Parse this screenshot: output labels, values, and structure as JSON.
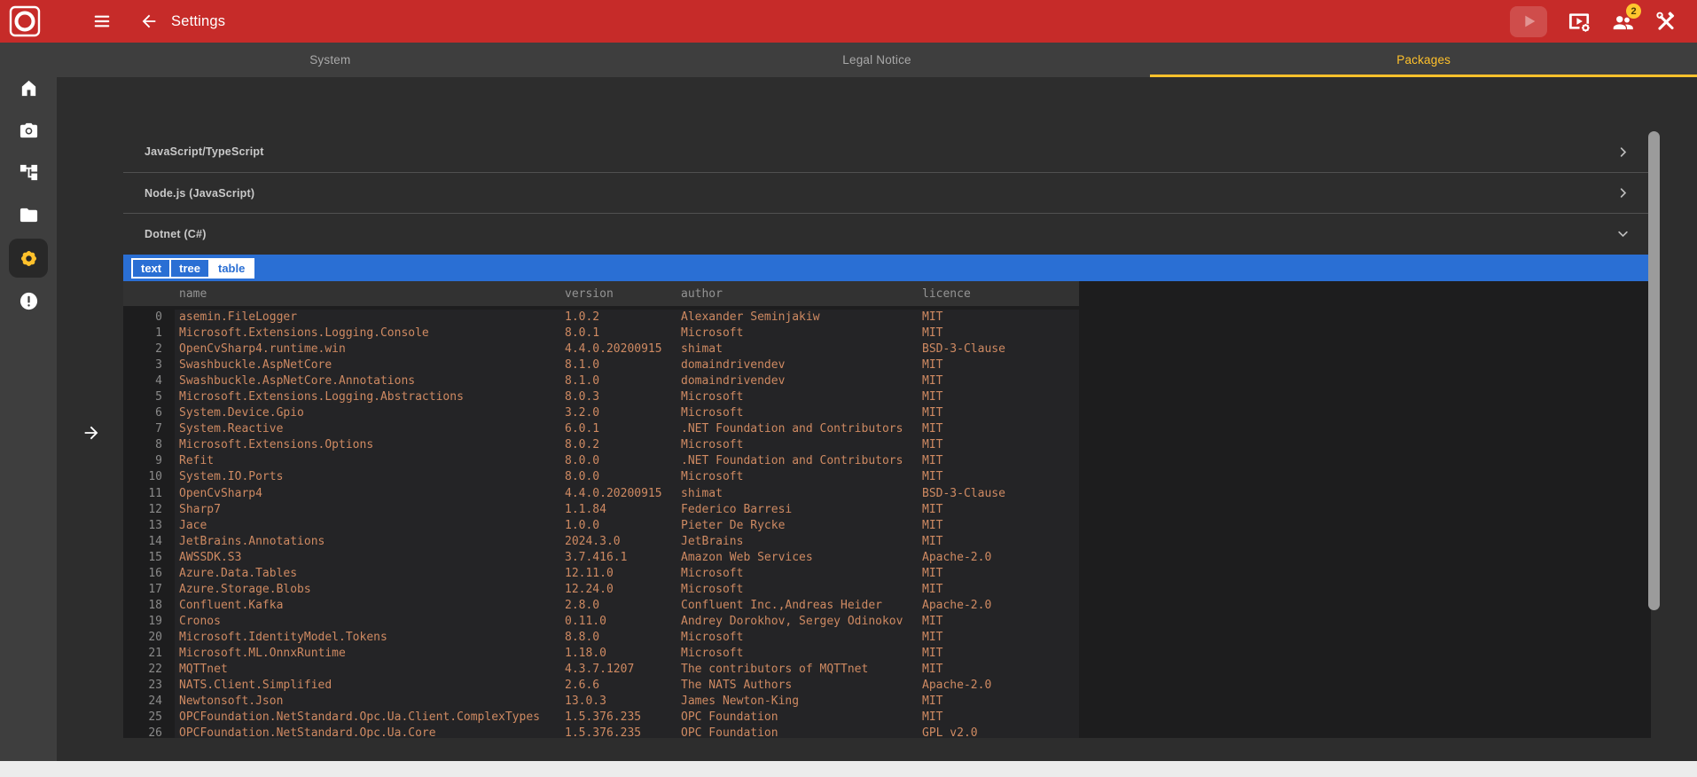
{
  "topbar": {
    "title": "Settings",
    "users_badge_count": "2"
  },
  "tabs": [
    {
      "label": "System",
      "active": false
    },
    {
      "label": "Legal Notice",
      "active": false
    },
    {
      "label": "Packages",
      "active": true
    }
  ],
  "sidebar": {
    "items": [
      {
        "icon": "home-icon",
        "active": false
      },
      {
        "icon": "camera-icon",
        "active": false
      },
      {
        "icon": "account-tree-icon",
        "active": false
      },
      {
        "icon": "folder-icon",
        "active": false
      },
      {
        "icon": "settings-gear-icon",
        "active": true
      },
      {
        "icon": "error-icon",
        "active": false
      }
    ]
  },
  "icons": [
    "logo-o",
    "hamburger-menu",
    "back-arrow",
    "play",
    "video-settings",
    "users",
    "construction-tools",
    "chevron-right",
    "chevron-down",
    "expand-right-arrow"
  ],
  "panels": [
    {
      "label": "JavaScript/TypeScript",
      "expanded": false
    },
    {
      "label": "Node.js (JavaScript)",
      "expanded": false
    },
    {
      "label": "Dotnet (C#)",
      "expanded": true
    }
  ],
  "view_toggle": {
    "options": [
      "text",
      "tree",
      "table"
    ],
    "selected": "table"
  },
  "table": {
    "columns": {
      "name": "name",
      "version": "version",
      "author": "author",
      "licence": "licence"
    },
    "rows": [
      {
        "i": "0",
        "name": "asemin.FileLogger",
        "version": "1.0.2",
        "author": "Alexander Seminjakiw",
        "licence": "MIT"
      },
      {
        "i": "1",
        "name": "Microsoft.Extensions.Logging.Console",
        "version": "8.0.1",
        "author": "Microsoft",
        "licence": "MIT"
      },
      {
        "i": "2",
        "name": "OpenCvSharp4.runtime.win",
        "version": "4.4.0.20200915",
        "author": "shimat",
        "licence": "BSD-3-Clause"
      },
      {
        "i": "3",
        "name": "Swashbuckle.AspNetCore",
        "version": "8.1.0",
        "author": "domaindrivendev",
        "licence": "MIT"
      },
      {
        "i": "4",
        "name": "Swashbuckle.AspNetCore.Annotations",
        "version": "8.1.0",
        "author": "domaindrivendev",
        "licence": "MIT"
      },
      {
        "i": "5",
        "name": "Microsoft.Extensions.Logging.Abstractions",
        "version": "8.0.3",
        "author": "Microsoft",
        "licence": "MIT"
      },
      {
        "i": "6",
        "name": "System.Device.Gpio",
        "version": "3.2.0",
        "author": "Microsoft",
        "licence": "MIT"
      },
      {
        "i": "7",
        "name": "System.Reactive",
        "version": "6.0.1",
        "author": ".NET Foundation and Contributors",
        "licence": "MIT"
      },
      {
        "i": "8",
        "name": "Microsoft.Extensions.Options",
        "version": "8.0.2",
        "author": "Microsoft",
        "licence": "MIT"
      },
      {
        "i": "9",
        "name": "Refit",
        "version": "8.0.0",
        "author": ".NET Foundation and Contributors",
        "licence": "MIT"
      },
      {
        "i": "10",
        "name": "System.IO.Ports",
        "version": "8.0.0",
        "author": "Microsoft",
        "licence": "MIT"
      },
      {
        "i": "11",
        "name": "OpenCvSharp4",
        "version": "4.4.0.20200915",
        "author": "shimat",
        "licence": "BSD-3-Clause"
      },
      {
        "i": "12",
        "name": "Sharp7",
        "version": "1.1.84",
        "author": "Federico Barresi",
        "licence": "MIT"
      },
      {
        "i": "13",
        "name": "Jace",
        "version": "1.0.0",
        "author": "Pieter De Rycke",
        "licence": "MIT"
      },
      {
        "i": "14",
        "name": "JetBrains.Annotations",
        "version": "2024.3.0",
        "author": "JetBrains",
        "licence": "MIT"
      },
      {
        "i": "15",
        "name": "AWSSDK.S3",
        "version": "3.7.416.1",
        "author": "Amazon Web Services",
        "licence": "Apache-2.0"
      },
      {
        "i": "16",
        "name": "Azure.Data.Tables",
        "version": "12.11.0",
        "author": "Microsoft",
        "licence": "MIT"
      },
      {
        "i": "17",
        "name": "Azure.Storage.Blobs",
        "version": "12.24.0",
        "author": "Microsoft",
        "licence": "MIT"
      },
      {
        "i": "18",
        "name": "Confluent.Kafka",
        "version": "2.8.0",
        "author": "Confluent Inc.,Andreas Heider",
        "licence": "Apache-2.0"
      },
      {
        "i": "19",
        "name": "Cronos",
        "version": "0.11.0",
        "author": "Andrey Dorokhov, Sergey Odinokov",
        "licence": "MIT"
      },
      {
        "i": "20",
        "name": "Microsoft.IdentityModel.Tokens",
        "version": "8.8.0",
        "author": "Microsoft",
        "licence": "MIT"
      },
      {
        "i": "21",
        "name": "Microsoft.ML.OnnxRuntime",
        "version": "1.18.0",
        "author": "Microsoft",
        "licence": "MIT"
      },
      {
        "i": "22",
        "name": "MQTTnet",
        "version": "4.3.7.1207",
        "author": "The contributors of MQTTnet",
        "licence": "MIT"
      },
      {
        "i": "23",
        "name": "NATS.Client.Simplified",
        "version": "2.6.6",
        "author": "The NATS Authors",
        "licence": "Apache-2.0"
      },
      {
        "i": "24",
        "name": "Newtonsoft.Json",
        "version": "13.0.3",
        "author": "James Newton-King",
        "licence": "MIT"
      },
      {
        "i": "25",
        "name": "OPCFoundation.NetStandard.Opc.Ua.Client.ComplexTypes",
        "version": "1.5.376.235",
        "author": "OPC Foundation",
        "licence": "MIT"
      },
      {
        "i": "26",
        "name": "OPCFoundation.NetStandard.Opc.Ua.Core",
        "version": "1.5.376.235",
        "author": "OPC Foundation",
        "licence": "GPL v2.0"
      }
    ]
  },
  "colors": {
    "brand_red": "#C62B29",
    "accent_amber": "#FFC12B",
    "toolbar_blue": "#2A6FD4",
    "package_text_orange": "#CF8A62",
    "sidebar_gray": "#3E3E3E",
    "content_gray": "#2D2D2D",
    "table_black": "#1D1D1E"
  }
}
